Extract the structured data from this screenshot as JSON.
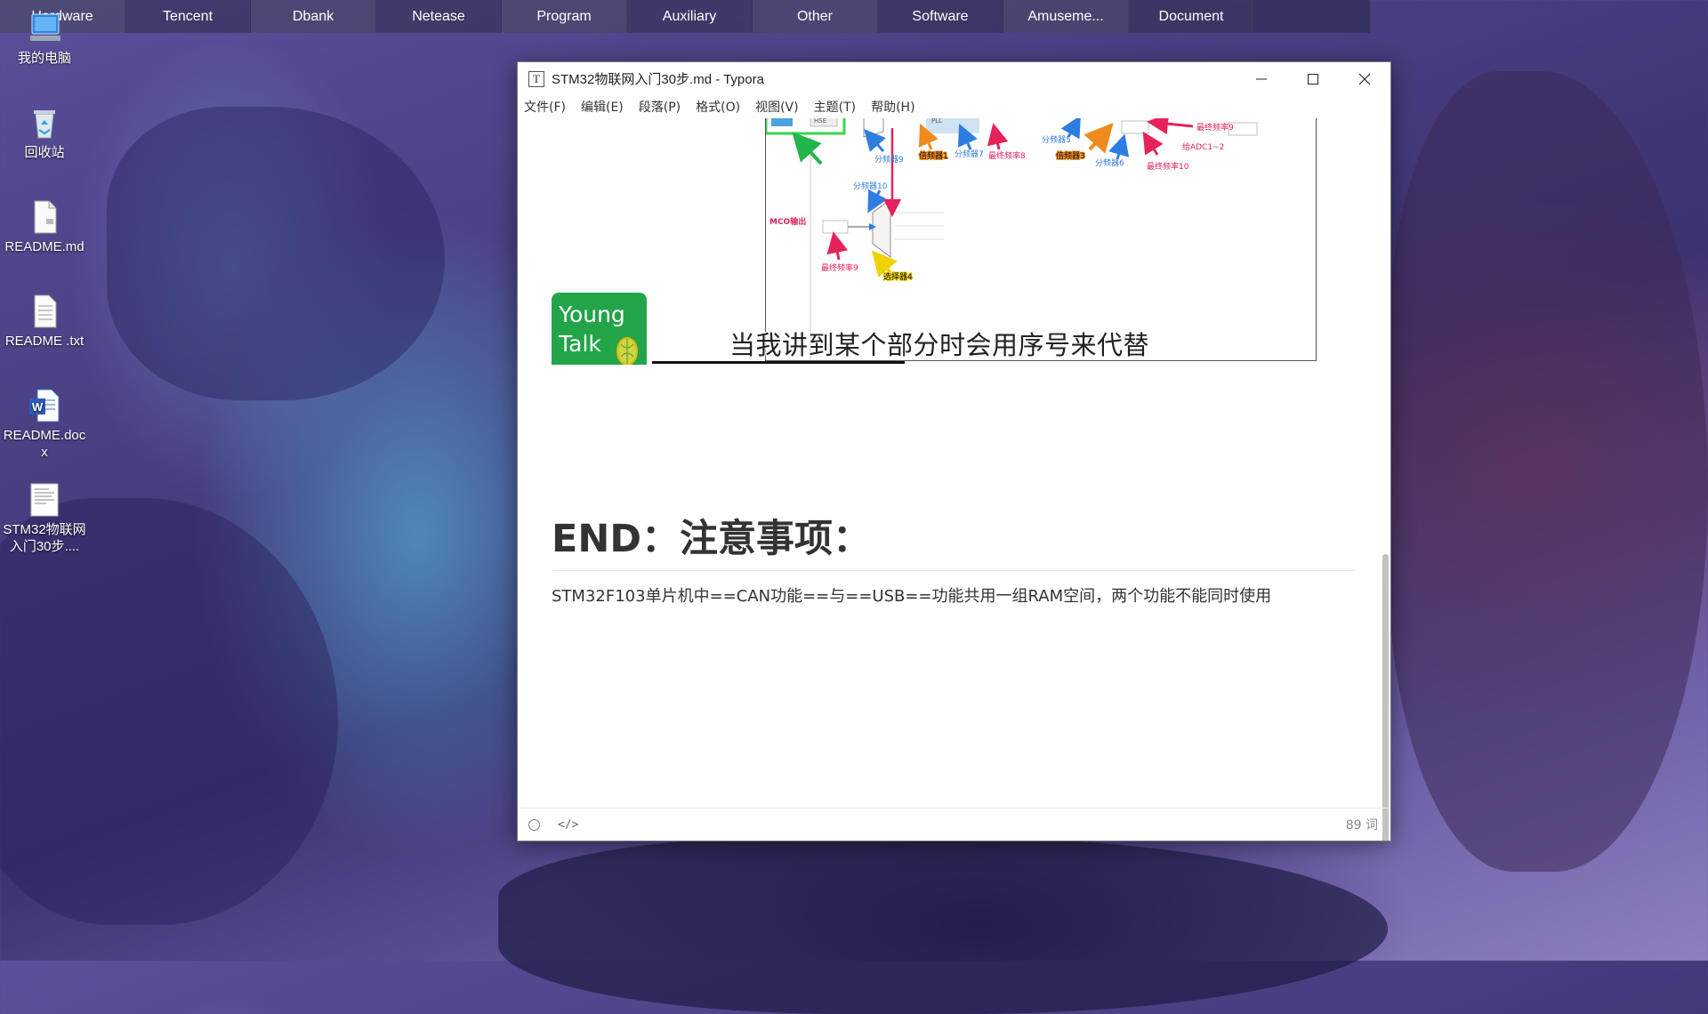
{
  "taskbar": {
    "items": [
      "Hardware",
      "Tencent",
      "Dbank",
      "Netease",
      "Program",
      "Auxiliary",
      "Other",
      "Software",
      "Amuseme...",
      "Document"
    ]
  },
  "desktop": {
    "icons": [
      {
        "label": "我的电脑",
        "icon": "computer-icon"
      },
      {
        "label": "回收站",
        "icon": "recycle-bin-icon"
      },
      {
        "label": "README.md",
        "icon": "markdown-file-icon"
      },
      {
        "label": "README .txt",
        "icon": "text-file-icon"
      },
      {
        "label": "README.docx",
        "icon": "word-file-icon"
      },
      {
        "label": "STM32物联网入门30步....",
        "icon": "document-thumbnail-icon"
      }
    ]
  },
  "window": {
    "title": "STM32物联网入门30步.md - Typora",
    "app_icon_letter": "T",
    "controls": {
      "minimize": "—",
      "maximize": "☐",
      "close": "✕"
    },
    "menu": [
      "文件(F)",
      "编辑(E)",
      "段落(P)",
      "格式(O)",
      "视图(V)",
      "主题(T)",
      "帮助(H)"
    ]
  },
  "document": {
    "video": {
      "logo_text_1": "Young",
      "logo_text_2": "Talk",
      "subtitle": "当我讲到某个部分时会用序号来代替",
      "diagram_labels": {
        "divider9": "分频器9",
        "divider10": "分频器10",
        "divider7": "分频器7",
        "divider5": "分频器5",
        "divider6": "分频器6",
        "mco": "MCO输出",
        "final8": "最终频率8",
        "final9": "最终频率9",
        "final10": "最终频率10",
        "adc": "给ADC1~2",
        "mult1": "倍频器1",
        "mult3": "倍频器3",
        "sel4": "选择器4",
        "hse": "HSE",
        "pll": "PLL"
      }
    },
    "heading": "END：注意事项：",
    "paragraph": "STM32F103单片机中==CAN功能==与==USB==功能共用一组RAM空间，两个功能不能同时使用"
  },
  "statusbar": {
    "code_toggle": "</>",
    "word_count": "89 词"
  },
  "colors": {
    "accent_green": "#22a548",
    "arrow_blue": "#2e7de0",
    "arrow_red": "#e5225a",
    "arrow_orange": "#f08a1c"
  }
}
